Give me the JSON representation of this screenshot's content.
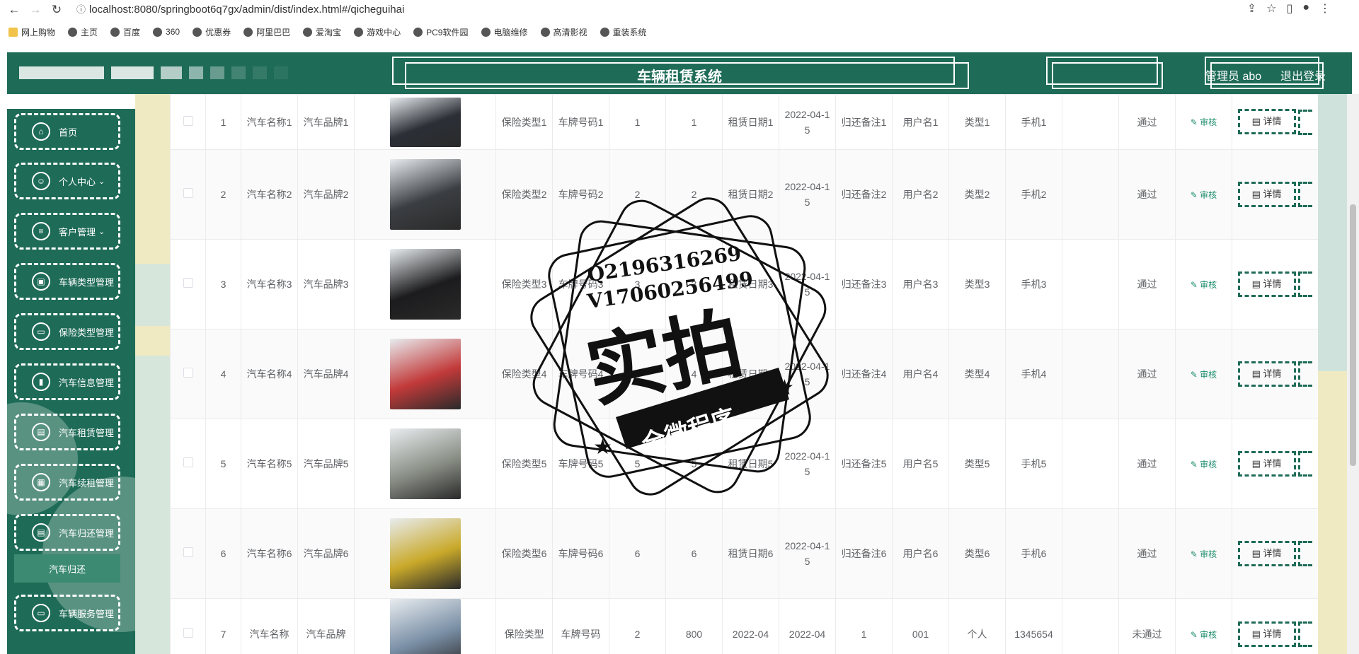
{
  "browser": {
    "url": "localhost:8080/springboot6q7gx/admin/dist/index.html#/qicheguihai",
    "bookmarks": [
      "网上购物",
      "主页",
      "百度",
      "360",
      "优惠券",
      "阿里巴巴",
      "爱淘宝",
      "游戏中心",
      "PC9软件园",
      "电脑维修",
      "高清影视",
      "重装系统"
    ]
  },
  "header": {
    "title": "车辆租赁系统",
    "user": "管理员 abo",
    "logout": "退出登录"
  },
  "sidebar": {
    "items": [
      {
        "label": "首页",
        "icon": "home-icon",
        "glyph": "⌂",
        "chev": ""
      },
      {
        "label": "个人中心",
        "icon": "user-icon",
        "glyph": "☺",
        "chev": "⌄"
      },
      {
        "label": "客户管理",
        "icon": "list-icon",
        "glyph": "≡",
        "chev": "⌄"
      },
      {
        "label": "车辆类型管理",
        "icon": "bag-icon",
        "glyph": "▣",
        "chev": ""
      },
      {
        "label": "保险类型管理",
        "icon": "monitor-icon",
        "glyph": "▭",
        "chev": ""
      },
      {
        "label": "汽车信息管理",
        "icon": "chart-icon",
        "glyph": "▮",
        "chev": ""
      },
      {
        "label": "汽车租赁管理",
        "icon": "chat-icon",
        "glyph": "▤",
        "chev": ""
      },
      {
        "label": "汽车续租管理",
        "icon": "grid-icon",
        "glyph": "▦",
        "chev": ""
      },
      {
        "label": "汽车归还管理",
        "icon": "chat-icon",
        "glyph": "▤",
        "chev": ""
      },
      {
        "label": "车辆服务管理",
        "icon": "monitor-icon",
        "glyph": "▭",
        "chev": ""
      }
    ],
    "submenu": "汽车归还"
  },
  "table": {
    "audit": "审核",
    "detail": "详情",
    "rows": [
      {
        "idx": "1",
        "name": "汽车名称1",
        "brand": "汽车品牌1",
        "ins": "保险类型1",
        "plate": "车牌号码1",
        "a": "1",
        "b": "1",
        "rdate": "租赁日期1",
        "date": "2022-04-15",
        "note": "归还备注1",
        "user": "用户名1",
        "type": "类型1",
        "phone": "手机1",
        "extra": "",
        "status": "通过",
        "img": "#2b2f36"
      },
      {
        "idx": "2",
        "name": "汽车名称2",
        "brand": "汽车品牌2",
        "ins": "保险类型2",
        "plate": "车牌号码2",
        "a": "2",
        "b": "2",
        "rdate": "租赁日期2",
        "date": "2022-04-15",
        "note": "归还备注2",
        "user": "用户名2",
        "type": "类型2",
        "phone": "手机2",
        "extra": "",
        "status": "通过",
        "img": "#3b3e42"
      },
      {
        "idx": "3",
        "name": "汽车名称3",
        "brand": "汽车品牌3",
        "ins": "保险类型3",
        "plate": "车牌号码3",
        "a": "3",
        "b": "3",
        "rdate": "租赁日期3",
        "date": "2022-04-15",
        "note": "归还备注3",
        "user": "用户名3",
        "type": "类型3",
        "phone": "手机3",
        "extra": "",
        "status": "通过",
        "img": "#1c1c1e"
      },
      {
        "idx": "4",
        "name": "汽车名称4",
        "brand": "汽车品牌4",
        "ins": "保险类型4",
        "plate": "车牌号码4",
        "a": "4",
        "b": "4",
        "rdate": "租赁日期4",
        "date": "2022-04-15",
        "note": "归还备注4",
        "user": "用户名4",
        "type": "类型4",
        "phone": "手机4",
        "extra": "",
        "status": "通过",
        "img": "#c23a3a"
      },
      {
        "idx": "5",
        "name": "汽车名称5",
        "brand": "汽车品牌5",
        "ins": "保险类型5",
        "plate": "车牌号码5",
        "a": "5",
        "b": "5",
        "rdate": "租赁日期5",
        "date": "2022-04-15",
        "note": "归还备注5",
        "user": "用户名5",
        "type": "类型5",
        "phone": "手机5",
        "extra": "",
        "status": "通过",
        "img": "#8a8f86"
      },
      {
        "idx": "6",
        "name": "汽车名称6",
        "brand": "汽车品牌6",
        "ins": "保险类型6",
        "plate": "车牌号码6",
        "a": "6",
        "b": "6",
        "rdate": "租赁日期6",
        "date": "2022-04-15",
        "note": "归还备注6",
        "user": "用户名6",
        "type": "类型6",
        "phone": "手机6",
        "extra": "",
        "status": "通过",
        "img": "#c9a92a"
      },
      {
        "idx": "7",
        "name": "汽车名称",
        "brand": "汽车品牌",
        "ins": "保险类型",
        "plate": "车牌号码",
        "a": "2",
        "b": "800",
        "rdate": "2022-04",
        "date": "2022-04",
        "note": "1",
        "user": "001",
        "type": "个人",
        "phone": "1345654",
        "extra": "",
        "status": "未通过",
        "img": "#7a8fa6"
      }
    ]
  },
  "watermark": {
    "line1": "Q2196316269",
    "line2": "V17060256499",
    "main": "实拍",
    "ribbon": "全微程序"
  },
  "colors": {
    "brand": "#1e6b57",
    "accent": "#1e8e6e"
  }
}
